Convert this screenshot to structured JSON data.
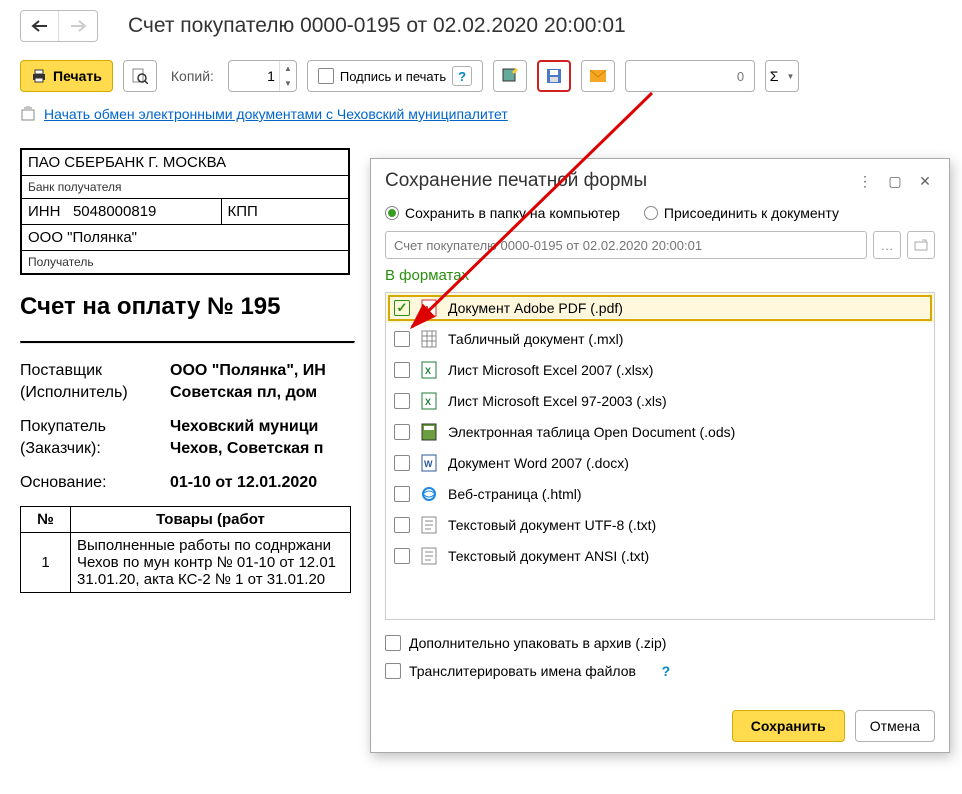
{
  "header": {
    "title": "Счет покупателю 0000-0195 от 02.02.2020 20:00:01"
  },
  "toolbar": {
    "print": "Печать",
    "copies_label": "Копий:",
    "copies_value": "1",
    "sign_stamp": "Подпись и печать",
    "count_value": "0",
    "sigma": "Σ"
  },
  "link_row": {
    "text": "Начать обмен электронными документами с Чеховский муниципалитет"
  },
  "doc": {
    "bank": "ПАО СБЕРБАНК Г. МОСКВА",
    "bank_label": "Банк получателя",
    "inn_label": "ИНН",
    "inn_value": "5048000819",
    "kpp_label": "КПП",
    "org": "ООО \"Полянка\"",
    "recipient_label": "Получатель",
    "heading": "Счет на оплату № 195",
    "supplier_label": "Поставщик",
    "supplier_label2": "(Исполнитель)",
    "supplier_value1": "ООО \"Полянка\", ИН",
    "supplier_value2": "Советская пл, дом",
    "buyer_label": "Покупатель",
    "buyer_label2": "(Заказчик):",
    "buyer_value1": "Чеховский муници",
    "buyer_value2": "Чехов, Советская п",
    "basis_label": "Основание:",
    "basis_value": "01-10 от 12.01.2020",
    "col_num": "№",
    "col_goods": "Товары (работ",
    "row_num": "1",
    "row_text": "Выполненные работы по соднржани\nЧехов по мун контр № 01-10 от 12.01\n31.01.20, акта КС-2 № 1 от 31.01.20"
  },
  "dialog": {
    "title": "Сохранение печатной формы",
    "radio_save": "Сохранить в папку на компьютер",
    "radio_attach": "Присоединить к документу",
    "filename_placeholder": "Счет покупателю 0000-0195 от 02.02.2020 20:00:01",
    "formats_label": "В форматах",
    "formats": [
      {
        "label": "Документ Adobe PDF (.pdf)",
        "checked": true,
        "icon": "pdf",
        "highlight": true
      },
      {
        "label": "Табличный документ (.mxl)",
        "checked": false,
        "icon": "mxl"
      },
      {
        "label": "Лист Microsoft Excel 2007 (.xlsx)",
        "checked": false,
        "icon": "xls"
      },
      {
        "label": "Лист Microsoft Excel 97-2003 (.xls)",
        "checked": false,
        "icon": "xls"
      },
      {
        "label": "Электронная таблица Open Document (.ods)",
        "checked": false,
        "icon": "ods"
      },
      {
        "label": "Документ Word 2007 (.docx)",
        "checked": false,
        "icon": "doc"
      },
      {
        "label": "Веб-страница (.html)",
        "checked": false,
        "icon": "html"
      },
      {
        "label": "Текстовый документ UTF-8 (.txt)",
        "checked": false,
        "icon": "txt"
      },
      {
        "label": "Текстовый документ ANSI (.txt)",
        "checked": false,
        "icon": "txt"
      }
    ],
    "zip_opt": "Дополнительно упаковать в архив (.zip)",
    "translit_opt": "Транслитерировать имена файлов",
    "save_btn": "Сохранить",
    "cancel_btn": "Отмена"
  }
}
